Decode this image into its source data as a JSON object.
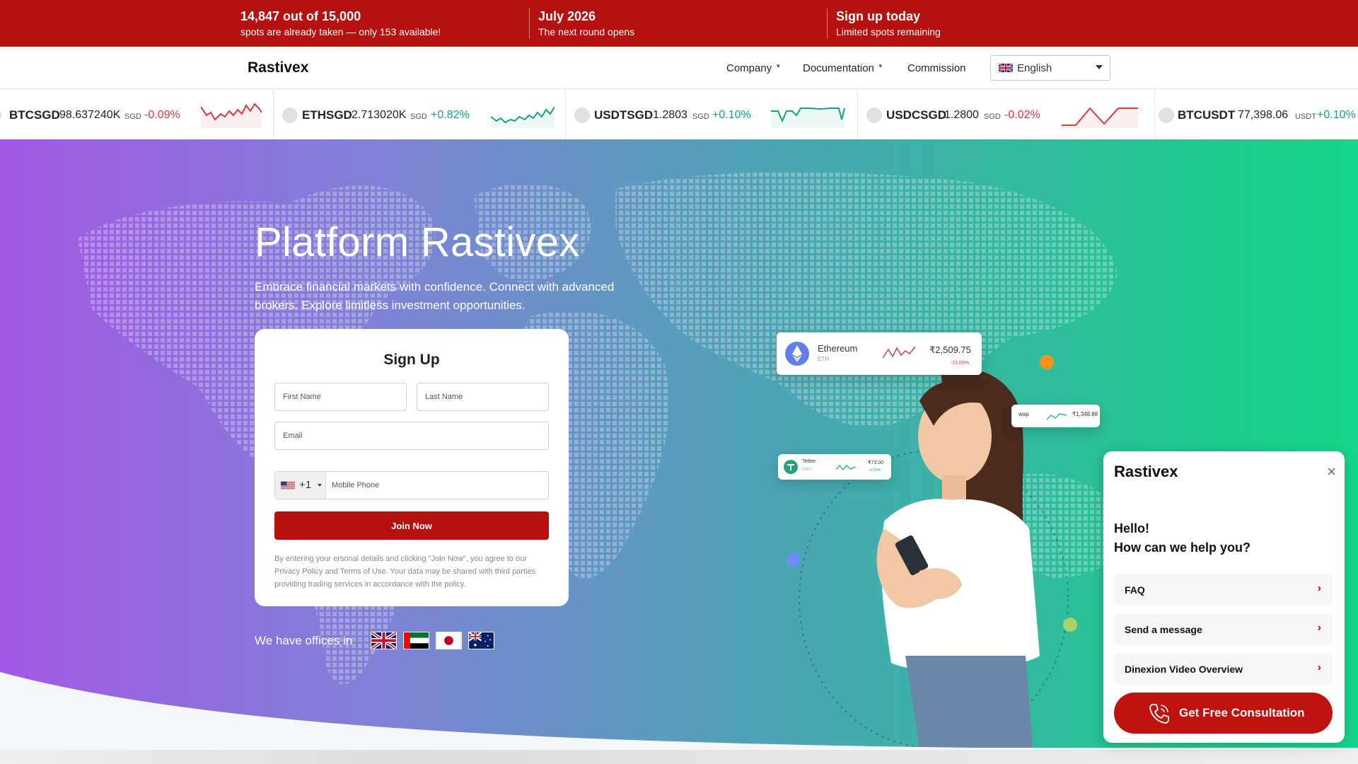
{
  "promo": [
    {
      "big": "14,847 out of 15,000",
      "small": "spots are already taken — only 153 available!"
    },
    {
      "big": "July 2026",
      "small": "The next round opens"
    },
    {
      "big": "Sign up today",
      "small": "Limited spots remaining"
    }
  ],
  "nav": {
    "logo": "Rastivex",
    "links": [
      "Company",
      "Documentation",
      "Commission"
    ],
    "language": "English"
  },
  "ticker": [
    {
      "symbol": "BTCSGD",
      "price": "98.637240K",
      "currency": "SGD",
      "change": "-0.09%",
      "direction": "down"
    },
    {
      "symbol": "ETHSGD",
      "price": "2.713020K",
      "currency": "SGD",
      "change": "+0.82%",
      "direction": "up"
    },
    {
      "symbol": "USDTSGD",
      "price": "1.2803",
      "currency": "SGD",
      "change": "+0.10%",
      "direction": "up"
    },
    {
      "symbol": "USDCSGD",
      "price": "1.2800",
      "currency": "SGD",
      "change": "-0.02%",
      "direction": "down"
    },
    {
      "symbol": "BTCUSDT",
      "price": "77,398.06",
      "currency": "USDT",
      "change": "+0.10%",
      "direction": "up"
    }
  ],
  "colors": {
    "brand_red": "#b5110f",
    "up": "#14a37f",
    "down": "#d9383a"
  },
  "hero": {
    "title": "Platform Rastivex",
    "subtitle": "Embrace financial markets with confidence. Connect with advanced brokers. Explore limitless investment opportunities."
  },
  "signup": {
    "title": "Sign Up",
    "first_name_placeholder": "First Name",
    "last_name_placeholder": "Last Name",
    "email_placeholder": "Email",
    "country_code": "+1",
    "phone_placeholder": "Mobile Phone",
    "submit_label": "Join Now",
    "legal": "By entering your ersonal details and clicking \"Join Now\", you agree to our Privacy Policy and Terms of Use. Your data may be shared with third parties providing trading services in accordance with the policy."
  },
  "offices": {
    "label": "We have offices in",
    "flags": [
      "uk-flag-icon",
      "uae-flag-icon",
      "japan-flag-icon",
      "australia-flag-icon"
    ]
  },
  "floating_cards": {
    "eth": {
      "name": "Ethereum",
      "ticker": "ETH",
      "price": "₹2,509.75",
      "change": "-21.00%"
    },
    "swap": {
      "name": "wap",
      "price": "₹1,348.88"
    },
    "tether": {
      "name": "Tether",
      "ticker": "USDT",
      "price": "₹73.00",
      "change": "+0.00%"
    }
  },
  "chat": {
    "title": "Rastivex",
    "greeting_1": "Hello!",
    "greeting_2": "How can we help you?",
    "options": [
      "FAQ",
      "Send a message",
      "Dinexion Video Overview"
    ],
    "cta": "Get Free Consultation"
  }
}
